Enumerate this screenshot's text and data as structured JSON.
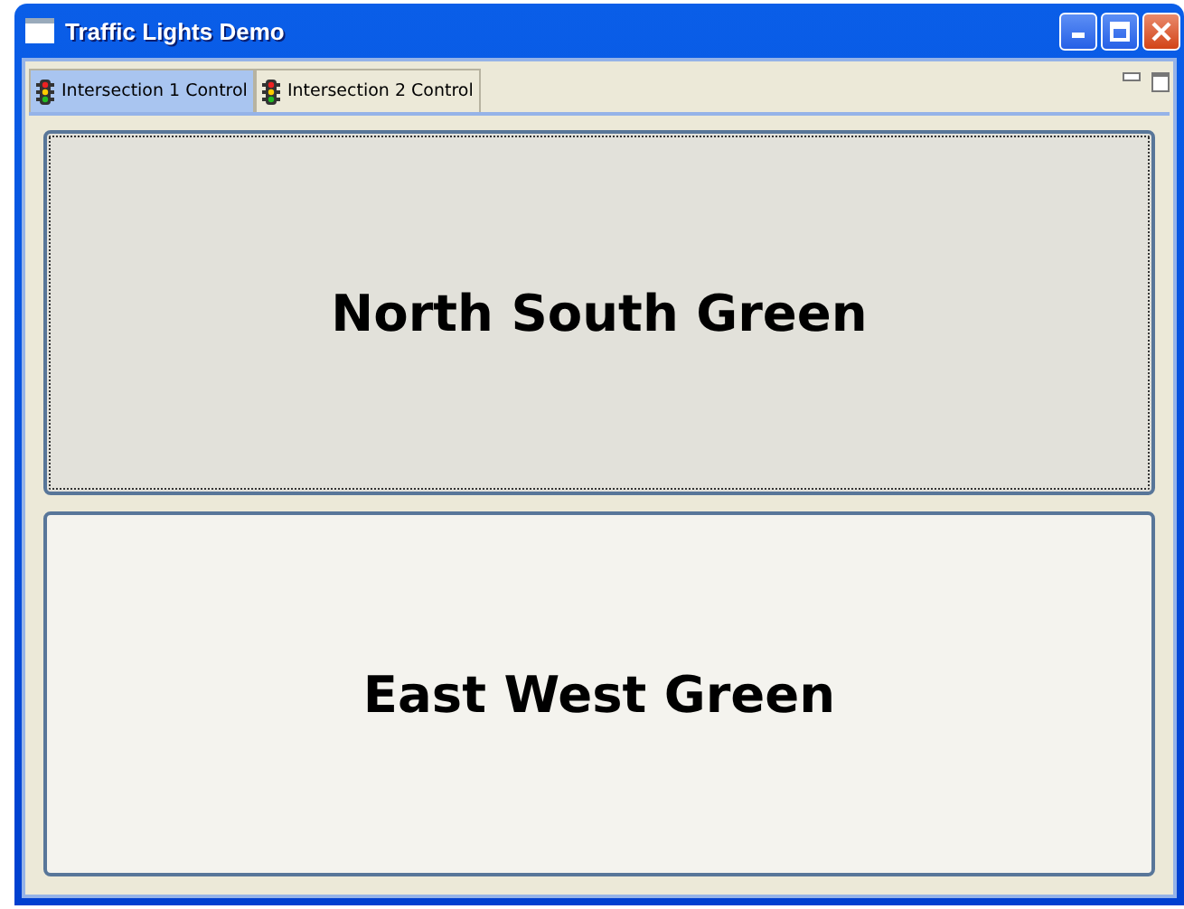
{
  "window": {
    "title": "Traffic Lights Demo"
  },
  "tabs": [
    {
      "label": "Intersection 1 Control",
      "selected": true
    },
    {
      "label": "Intersection 2 Control",
      "selected": false
    }
  ],
  "buttons": [
    {
      "label": "North South Green",
      "pressed": true
    },
    {
      "label": "East West Green",
      "pressed": false
    }
  ]
}
